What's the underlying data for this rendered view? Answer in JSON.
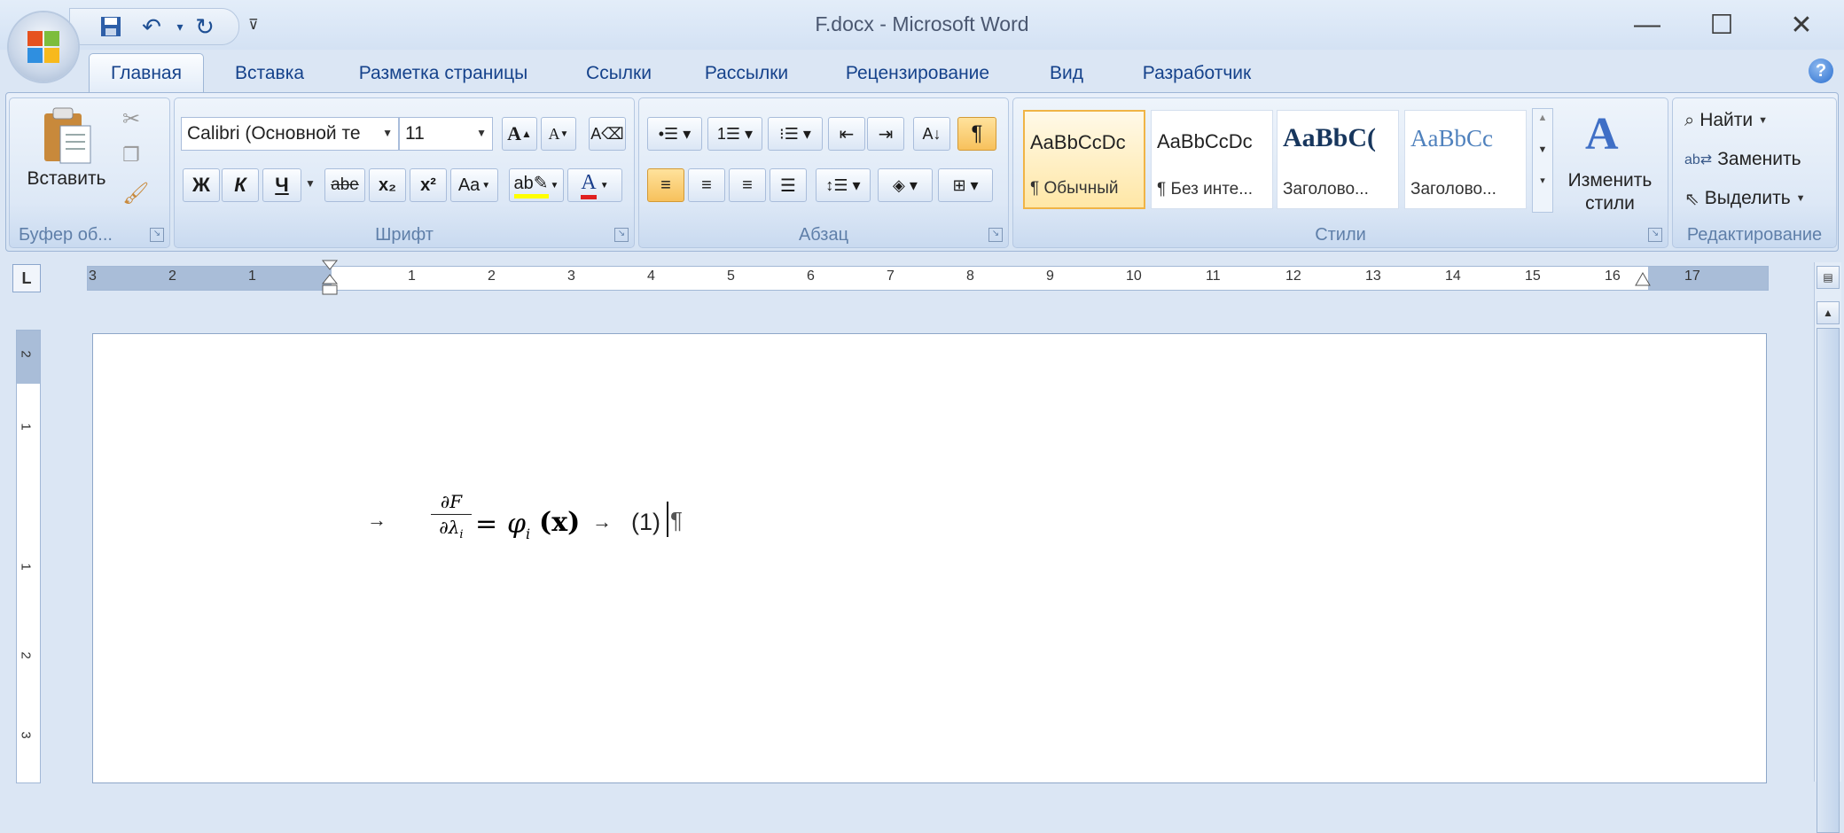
{
  "window": {
    "title": "F.docx - Microsoft Word"
  },
  "qat": {
    "save_icon": "save-icon",
    "undo_icon": "undo-icon",
    "redo_icon": "redo-icon",
    "customize_icon": "customize-qat-icon"
  },
  "tabs": [
    {
      "label": "Главная",
      "active": true
    },
    {
      "label": "Вставка"
    },
    {
      "label": "Разметка страницы"
    },
    {
      "label": "Ссылки"
    },
    {
      "label": "Рассылки"
    },
    {
      "label": "Рецензирование"
    },
    {
      "label": "Вид"
    },
    {
      "label": "Разработчик"
    }
  ],
  "clipboard": {
    "paste_label": "Вставить",
    "group_label": "Буфер об..."
  },
  "font": {
    "font_name": "Calibri (Основной те",
    "font_size": "11",
    "bold": "Ж",
    "italic": "К",
    "underline": "Ч",
    "strike": "abe",
    "subscript": "x₂",
    "superscript": "x²",
    "case": "Aa",
    "grow": "A",
    "shrink": "A",
    "group_label": "Шрифт"
  },
  "paragraph": {
    "pilcrow": "¶",
    "group_label": "Абзац"
  },
  "styles": {
    "tiles": [
      {
        "sample": "AaBbCcDc",
        "name": "¶ Обычный"
      },
      {
        "sample": "AaBbCcDc",
        "name": "¶ Без инте..."
      },
      {
        "sample": "AaBbC(",
        "name": "Заголово..."
      },
      {
        "sample": "AaBbCc",
        "name": "Заголово..."
      }
    ],
    "change_label_1": "Изменить",
    "change_label_2": "стили",
    "group_label": "Стили"
  },
  "editing": {
    "find": "Найти",
    "replace": "Заменить",
    "select": "Выделить",
    "group_label": "Редактирование"
  },
  "ruler": {
    "tab_selector": "L",
    "left_numbers": [
      "3",
      "2",
      "1"
    ],
    "right_numbers": [
      "1",
      "2",
      "3",
      "4",
      "5",
      "6",
      "7",
      "8",
      "9",
      "10",
      "11",
      "12",
      "13",
      "14",
      "15",
      "16",
      "17"
    ],
    "vertical_numbers": [
      "2",
      "1",
      "1",
      "2",
      "3"
    ]
  },
  "document": {
    "arrow": "→",
    "frac_num": "∂F",
    "frac_den": "∂λ",
    "frac_den_sub": "i",
    "equals": "=",
    "phi": "φ",
    "phi_sub": "i",
    "arg": "(x)",
    "eq_number": "(1)",
    "pilcrow": "¶"
  },
  "colors": {
    "accent": "#15428b",
    "selection": "#f0b446",
    "ribbon_bg": "#dbe6f4"
  }
}
